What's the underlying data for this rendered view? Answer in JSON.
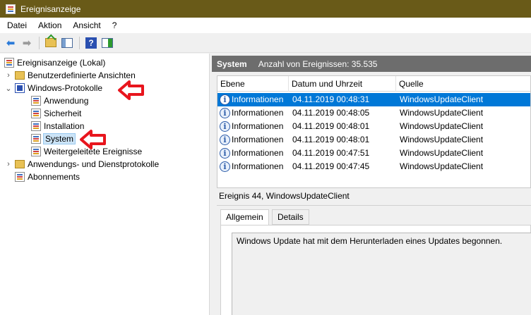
{
  "window": {
    "title": "Ereignisanzeige"
  },
  "menu": [
    "Datei",
    "Aktion",
    "Ansicht",
    "?"
  ],
  "toolbar": {
    "back_icon": "arrow-left-icon",
    "forward_icon": "arrow-right-icon",
    "help_label": "?"
  },
  "tree": {
    "root": "Ereignisanzeige (Lokal)",
    "custom_views": "Benutzerdefinierte Ansichten",
    "windows_logs": "Windows-Protokolle",
    "logs": [
      "Anwendung",
      "Sicherheit",
      "Installation",
      "System",
      "Weitergeleitete Ereignisse"
    ],
    "app_service_logs": "Anwendungs- und Dienstprotokolle",
    "subscriptions": "Abonnements",
    "selected": "System"
  },
  "events_panel": {
    "title": "System",
    "count_text": "Anzahl von Ereignissen: 35.535",
    "columns": [
      "Ebene",
      "Datum und Uhrzeit",
      "Quelle"
    ],
    "rows": [
      {
        "level": "Informationen",
        "datetime": "04.11.2019 00:48:31",
        "source": "WindowsUpdateClient",
        "selected": true
      },
      {
        "level": "Informationen",
        "datetime": "04.11.2019 00:48:05",
        "source": "WindowsUpdateClient",
        "selected": false
      },
      {
        "level": "Informationen",
        "datetime": "04.11.2019 00:48:01",
        "source": "WindowsUpdateClient",
        "selected": false
      },
      {
        "level": "Informationen",
        "datetime": "04.11.2019 00:48:01",
        "source": "WindowsUpdateClient",
        "selected": false
      },
      {
        "level": "Informationen",
        "datetime": "04.11.2019 00:47:51",
        "source": "WindowsUpdateClient",
        "selected": false
      },
      {
        "level": "Informationen",
        "datetime": "04.11.2019 00:47:45",
        "source": "WindowsUpdateClient",
        "selected": false
      }
    ]
  },
  "detail": {
    "title": "Ereignis 44, WindowsUpdateClient",
    "tabs": [
      "Allgemein",
      "Details"
    ],
    "message": "Windows Update hat mit dem Herunterladen eines Updates begonnen."
  },
  "colors": {
    "titlebar": "#695a18",
    "selection": "#0078d7",
    "annotation_arrow": "#e8151d"
  }
}
